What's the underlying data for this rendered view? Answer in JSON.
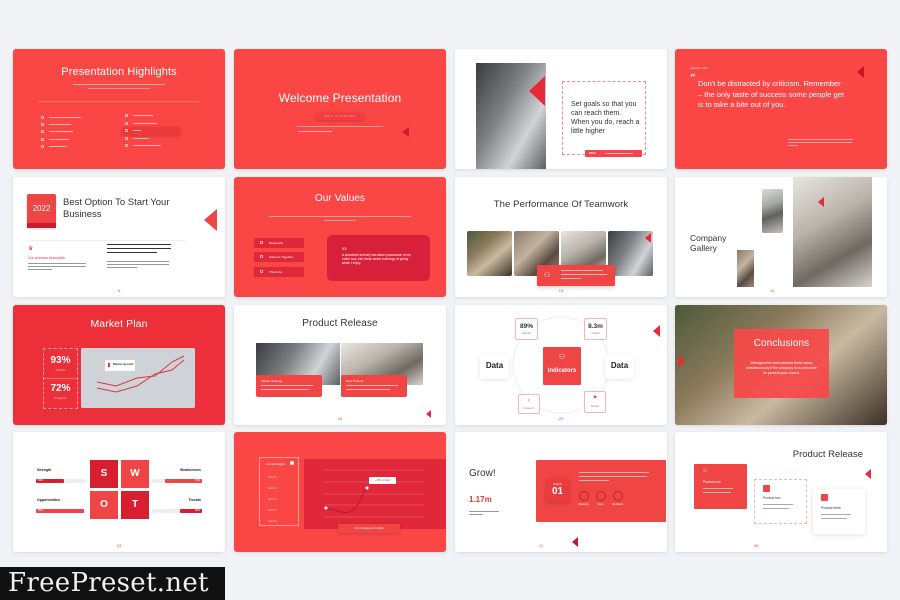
{
  "page": {
    "background": "#f1f2f5",
    "accent": "#fb4646",
    "accent_dark": "#e02a3a"
  },
  "slides": [
    {
      "id": 1,
      "title": "Presentation Highlights",
      "theme": "red"
    },
    {
      "id": 2,
      "title": "Welcome Presentation",
      "theme": "red",
      "button": "GET STARTED"
    },
    {
      "id": 3,
      "theme": "white",
      "quote": "Set goals so that you can reach them. When you do, reach a little higher",
      "badge": "2022"
    },
    {
      "id": 4,
      "theme": "red",
      "label": "Speaker Talk",
      "quote": "Don't be distracted by criticism. Remember – the only taste of success some people get is to take a bite out of you."
    },
    {
      "id": 5,
      "theme": "white",
      "year": "2022",
      "title": "Best Option To Start Your Business",
      "subheading": "Our business description",
      "page": "6"
    },
    {
      "id": 6,
      "theme": "red",
      "title": "Our Values",
      "values": [
        "Respectful",
        "Advance Together",
        "Think Lite"
      ],
      "card_number": "03",
      "card_text": "A wonderful serenity has taken possession of my entire soul, like these sweet mornings of spring which I enjoy."
    },
    {
      "id": 7,
      "theme": "white",
      "title": "The Performance Of Teamwork",
      "page": "13"
    },
    {
      "id": 8,
      "theme": "white",
      "title": "Company Gallery",
      "page": "14"
    },
    {
      "id": 9,
      "theme": "red",
      "title": "Market Plan",
      "stats": [
        {
          "value": "93%",
          "label": "Growth"
        },
        {
          "value": "72%",
          "label": "Progress"
        }
      ],
      "chart_label": "Market growth"
    },
    {
      "id": 10,
      "theme": "white",
      "title": "Product Release",
      "cards": [
        "Market Strategy",
        "New Product"
      ],
      "page": "16"
    },
    {
      "id": 11,
      "theme": "white",
      "center": "Indicators",
      "left": "Data",
      "right": "Data",
      "top_left": {
        "value": "89%",
        "label": "Startups"
      },
      "top_right": {
        "value": "8.3m",
        "label": "Insights"
      },
      "bottom_left": "Research",
      "bottom_right": "Results",
      "page": "20"
    },
    {
      "id": 12,
      "theme": "photo",
      "title": "Conclusions",
      "text": "Management must address these areas simultaneously if the company is to overcome its present poor record."
    },
    {
      "id": 13,
      "theme": "white",
      "swot": [
        "S",
        "W",
        "O",
        "T"
      ],
      "labels": [
        "Strength",
        "Weaknesses",
        "Opportunities",
        "Threats"
      ],
      "bars": [
        {
          "pct": "56%",
          "value": 0.56
        },
        {
          "pct": "75%",
          "value": 0.75
        },
        {
          "pct": "95%",
          "value": 0.95
        },
        {
          "pct": "45%",
          "value": 0.45
        }
      ],
      "page": "23"
    },
    {
      "id": 14,
      "theme": "red",
      "panel_title": "Annual Insights",
      "items": [
        "Item 01",
        "Item 02",
        "Item 03",
        "Item 04",
        "Item 05"
      ],
      "tooltip": "+45% Growth",
      "footer": "Tips: Update your Insights"
    },
    {
      "id": 15,
      "theme": "white",
      "title": "Grow!",
      "stat": "1.17m",
      "project_label": "Project",
      "project_number": "01",
      "circles": [
        "Marketing",
        "Sales",
        "Tax Return"
      ],
      "page": "11"
    },
    {
      "id": 16,
      "theme": "white",
      "title": "Product Release",
      "products": [
        "Product one",
        "Product two",
        "Product three"
      ],
      "page": "28"
    }
  ],
  "watermark": "FreePreset.net"
}
